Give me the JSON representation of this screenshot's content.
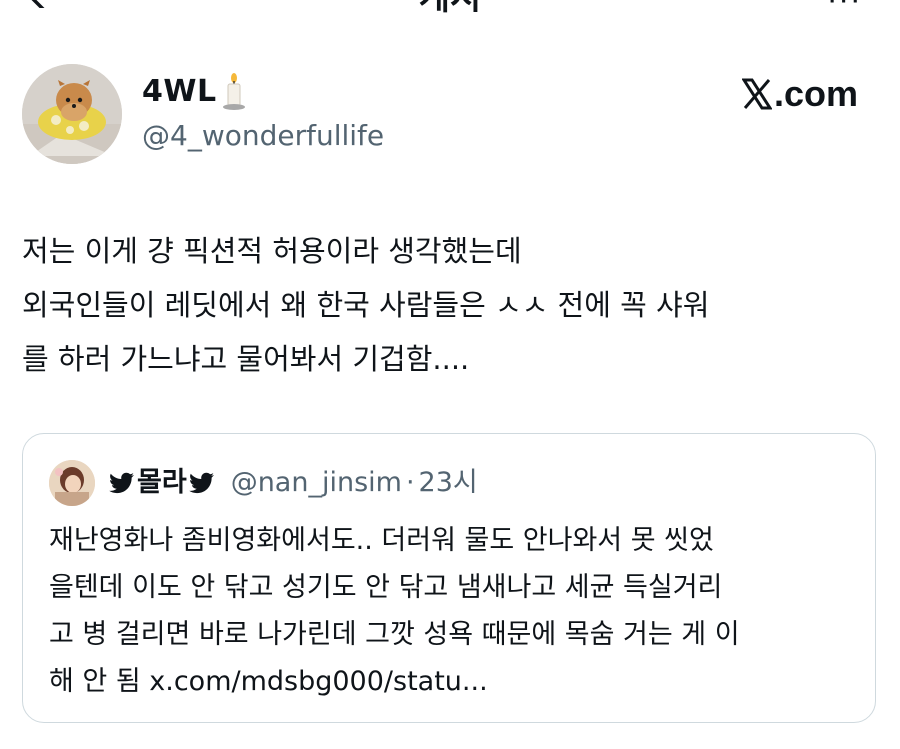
{
  "top_bar": {
    "title": "게시",
    "more": "···"
  },
  "author": {
    "display_name": "4WL",
    "handle": "@4_wonderfullife",
    "emoji_icon": "candle-icon"
  },
  "source": {
    "label": "𝕏.com",
    "text": ".com",
    "icon": "x-logo-icon"
  },
  "tweet": {
    "lines": [
      "저는 이게 걍 픽션적 허용이라 생각했는데",
      "외국인들이 레딧에서 왜 한국 사람들은 ㅅㅅ 전에 꼭 샤워",
      "를 하러 가느냐고 물어봐서 기겁함...."
    ]
  },
  "quoted_tweet": {
    "name": "몰라",
    "handle": "@nan_jinsim",
    "separator": "·",
    "time": "23시",
    "lines": [
      "재난영화나 좀비영화에서도.. 더러워 물도 안나와서 못 씻었",
      "을텐데 이도 안 닦고 성기도 안 닦고 냄새나고 세균 득실거리",
      "고 병 걸리면 바로 나가린데 그깟 성욕 때문에 목숨 거는 게 이",
      "해 안 됨 x.com/mdsbg000/statu..."
    ]
  }
}
